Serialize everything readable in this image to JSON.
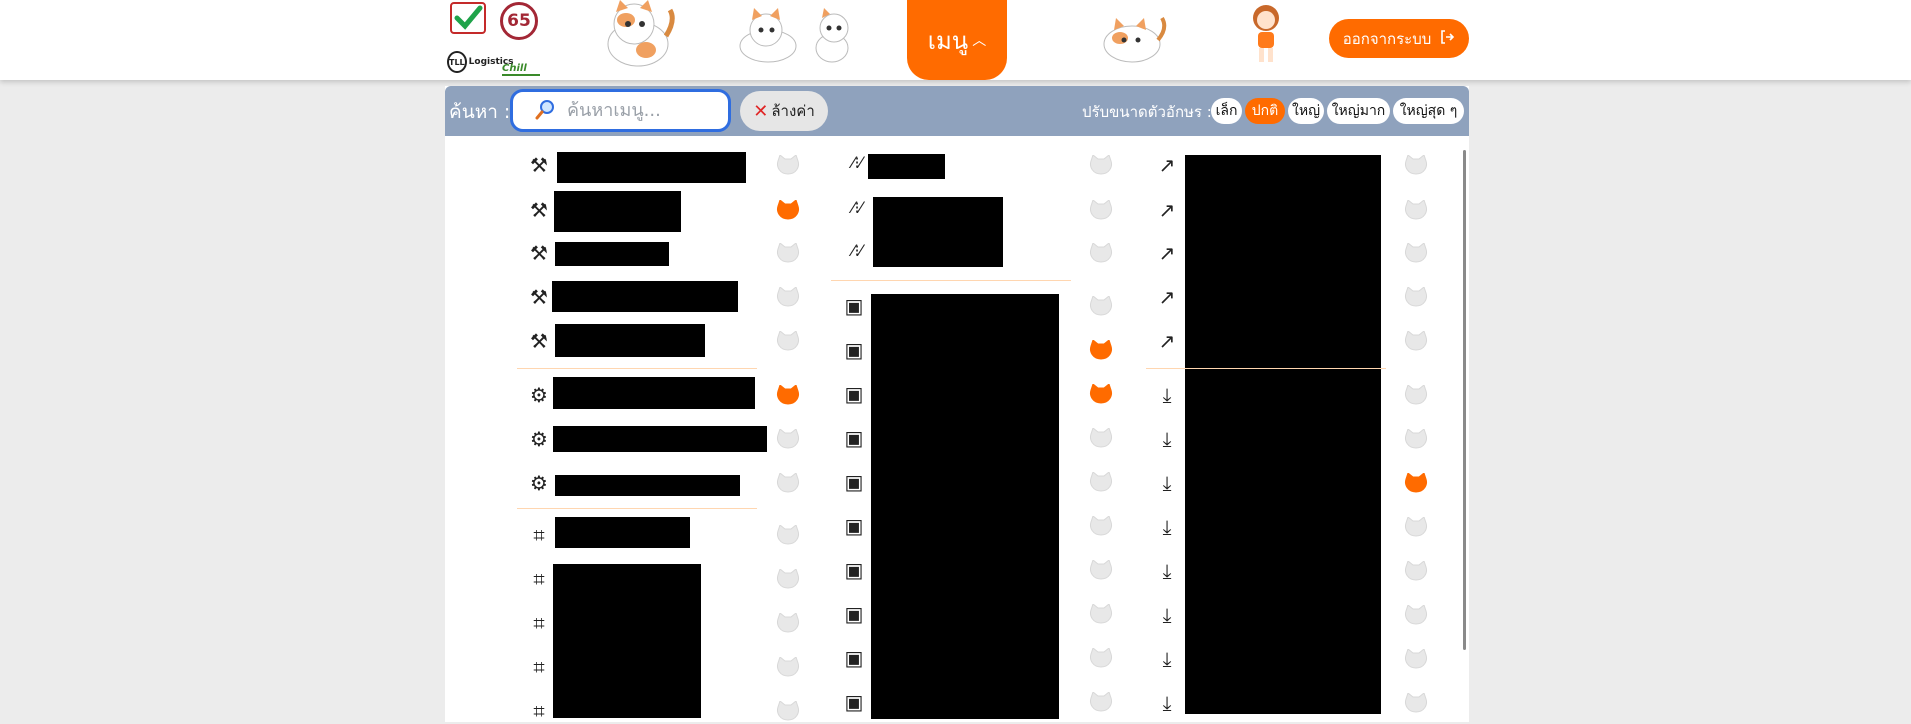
{
  "header": {
    "logos": {
      "badge_65": "65",
      "tll_mark": "TLL",
      "tll_text": "Logistics",
      "chill_text": "Chill"
    },
    "menu_label": "เมนู",
    "logout_label": "ออกจากระบบ"
  },
  "search": {
    "label": "ค้นหา :",
    "placeholder": "ค้นหาเมนู...",
    "clear_label": "ล้างค่า"
  },
  "font_size": {
    "label": "ปรับขนาดตัวอักษร :",
    "options": [
      "เล็ก",
      "ปกติ",
      "ใหญ่",
      "ใหญ่มาก",
      "ใหญ่สุด ๆ"
    ],
    "selected": "ปกติ"
  },
  "menu": {
    "column_1": [
      {
        "icon": "tools-icon",
        "favorite": false
      },
      {
        "icon": "tools-icon",
        "favorite": true
      },
      {
        "icon": "tools-icon",
        "favorite": false
      },
      {
        "icon": "tools-icon",
        "favorite": false
      },
      {
        "icon": "tools-icon",
        "favorite": false
      },
      {
        "icon": "gear-shield-icon",
        "favorite": true
      },
      {
        "icon": "gear-shield-icon",
        "favorite": false
      },
      {
        "icon": "gear-shield-icon",
        "favorite": false
      },
      {
        "icon": "frame-icon",
        "favorite": false
      },
      {
        "icon": "frame-icon",
        "favorite": false
      },
      {
        "icon": "frame-icon",
        "favorite": false
      },
      {
        "icon": "frame-icon",
        "favorite": false
      },
      {
        "icon": "frame-icon",
        "favorite": false
      }
    ],
    "column_2": [
      {
        "icon": "road-icon",
        "favorite": false
      },
      {
        "icon": "road-icon",
        "favorite": false
      },
      {
        "icon": "road-icon",
        "favorite": false
      },
      {
        "icon": "monitor-icon",
        "favorite": false
      },
      {
        "icon": "monitor-icon",
        "favorite": true
      },
      {
        "icon": "monitor-icon",
        "favorite": true
      },
      {
        "icon": "monitor-icon",
        "favorite": false
      },
      {
        "icon": "monitor-icon",
        "favorite": false
      },
      {
        "icon": "monitor-icon",
        "favorite": false
      },
      {
        "icon": "monitor-icon",
        "favorite": false
      },
      {
        "icon": "monitor-icon",
        "favorite": false
      },
      {
        "icon": "monitor-icon",
        "favorite": false
      },
      {
        "icon": "monitor-icon",
        "favorite": false
      }
    ],
    "column_3": [
      {
        "icon": "external-link-icon",
        "favorite": false
      },
      {
        "icon": "external-link-icon",
        "favorite": false
      },
      {
        "icon": "external-link-icon",
        "favorite": false
      },
      {
        "icon": "external-link-icon",
        "favorite": false
      },
      {
        "icon": "external-link-icon",
        "favorite": false
      },
      {
        "icon": "download-icon",
        "favorite": false
      },
      {
        "icon": "download-icon",
        "favorite": false
      },
      {
        "icon": "download-icon",
        "favorite": true
      },
      {
        "icon": "download-icon",
        "favorite": false
      },
      {
        "icon": "download-icon",
        "favorite": false
      },
      {
        "icon": "download-icon",
        "favorite": false
      },
      {
        "icon": "download-icon",
        "favorite": false
      },
      {
        "icon": "download-icon",
        "favorite": false
      }
    ]
  },
  "colors": {
    "accent": "#ff6b00",
    "search_bar": "#8fa2bd",
    "search_border": "#2f6de0"
  }
}
